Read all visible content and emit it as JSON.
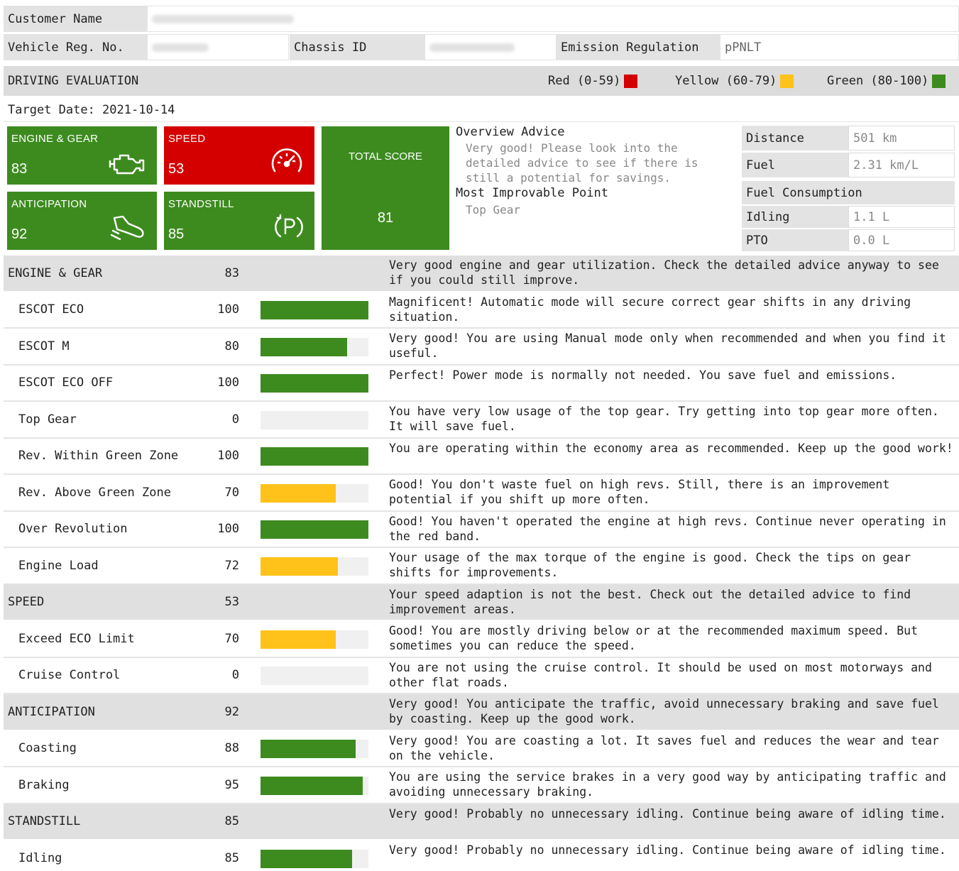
{
  "header": {
    "customer_name_label": "Customer Name",
    "vehicle_reg_label": "Vehicle Reg. No.",
    "chassis_label": "Chassis ID",
    "emission_label": "Emission Regulation",
    "emission_value": "pPNLT"
  },
  "evaluation": {
    "title": "DRIVING EVALUATION",
    "legend": [
      {
        "label": "Red (0-59)",
        "color": "#d40000"
      },
      {
        "label": "Yellow (60-79)",
        "color": "#ffc21a"
      },
      {
        "label": "Green (80-100)",
        "color": "#3d8b1f"
      }
    ],
    "target_date": "Target Date: 2021-10-14"
  },
  "tiles": {
    "engine_gear": {
      "label": "ENGINE & GEAR",
      "value": "83",
      "icon": "engine-icon"
    },
    "speed": {
      "label": "SPEED",
      "value": "53",
      "icon": "speedometer-icon"
    },
    "anticipation": {
      "label": "ANTICIPATION",
      "value": "92",
      "icon": "coasting-foot-icon"
    },
    "standstill": {
      "label": "STANDSTILL",
      "value": "85",
      "icon": "parking-icon"
    },
    "total": {
      "label": "TOTAL SCORE",
      "value": "81"
    }
  },
  "advice": {
    "overview_title": "Overview Advice",
    "overview_text": "Very good! Please look into the detailed advice to see if there is still a potential for savings.",
    "improvable_title": "Most Improvable Point",
    "improvable_value": "Top Gear"
  },
  "stats": {
    "distance_label": "Distance",
    "distance_value": "501 km",
    "fuel_label": "Fuel",
    "fuel_value": "2.31 km/L",
    "consumption_label": "Fuel Consumption",
    "idling_label": "Idling",
    "idling_value": "1.1 L",
    "pto_label": "PTO",
    "pto_value": "0.0 L"
  },
  "colors": {
    "green": "#3d8b1f",
    "yellow": "#ffc21a",
    "red": "#d40000"
  },
  "rows": [
    {
      "name": "ENGINE & GEAR",
      "score": "83",
      "section": true,
      "text": "Very good engine and gear utilization. Check the detailed advice anyway to see if you could still improve."
    },
    {
      "name": "ESCOT ECO",
      "score": "100",
      "section": false,
      "pct": 100,
      "color": "green",
      "text": "Magnificent! Automatic mode will secure correct gear shifts in any driving situation."
    },
    {
      "name": "ESCOT M",
      "score": "80",
      "section": false,
      "pct": 80,
      "color": "green",
      "text": "Very good! You are using Manual mode only when recommended and when you find it useful."
    },
    {
      "name": "ESCOT ECO OFF",
      "score": "100",
      "section": false,
      "pct": 100,
      "color": "green",
      "text": "Perfect! Power mode is normally not needed. You save fuel and emissions."
    },
    {
      "name": "Top Gear",
      "score": "0",
      "section": false,
      "pct": 0,
      "color": "green",
      "text": "You have very low usage of the top gear. Try getting into top gear more often. It will save fuel."
    },
    {
      "name": "Rev. Within Green Zone",
      "score": "100",
      "section": false,
      "pct": 100,
      "color": "green",
      "text": "You are operating within the economy area as recommended. Keep up the good work!"
    },
    {
      "name": "Rev. Above Green Zone",
      "score": "70",
      "section": false,
      "pct": 70,
      "color": "yellow",
      "text": "Good! You don't waste fuel on high revs. Still, there is an improvement potential if you shift up more often."
    },
    {
      "name": "Over Revolution",
      "score": "100",
      "section": false,
      "pct": 100,
      "color": "green",
      "text": "Good! You haven't operated the engine at high revs. Continue never operating in the red band."
    },
    {
      "name": "Engine Load",
      "score": "72",
      "section": false,
      "pct": 72,
      "color": "yellow",
      "text": "Your usage of the max torque of the engine is good. Check the tips on gear shifts for improvements."
    },
    {
      "name": "SPEED",
      "score": "53",
      "section": true,
      "text": "Your speed adaption is not the best. Check out the detailed advice to find improvement areas."
    },
    {
      "name": "Exceed ECO Limit",
      "score": "70",
      "section": false,
      "pct": 70,
      "color": "yellow",
      "text": "Good! You are mostly driving below or at the recommended maximum speed. But sometimes you can reduce the speed."
    },
    {
      "name": "Cruise Control",
      "score": "0",
      "section": false,
      "pct": 0,
      "color": "green",
      "text": "You are not using the cruise control. It should be used on most motorways and other flat roads."
    },
    {
      "name": "ANTICIPATION",
      "score": "92",
      "section": true,
      "text": "Very good! You anticipate the traffic, avoid unnecessary braking and save fuel by coasting. Keep up the good work."
    },
    {
      "name": "Coasting",
      "score": "88",
      "section": false,
      "pct": 88,
      "color": "green",
      "text": "Very good! You are coasting a lot. It saves fuel and reduces the wear and tear on the vehicle."
    },
    {
      "name": "Braking",
      "score": "95",
      "section": false,
      "pct": 95,
      "color": "green",
      "text": "You are using the service brakes in a very good way by anticipating traffic and avoiding unnecessary braking."
    },
    {
      "name": "STANDSTILL",
      "score": "85",
      "section": true,
      "text": "Very good! Probably no unnecessary idling. Continue being aware of idling time."
    },
    {
      "name": "Idling",
      "score": "85",
      "section": false,
      "pct": 85,
      "color": "green",
      "text": "Very good! Probably no unnecessary idling. Continue being aware of idling time."
    }
  ]
}
